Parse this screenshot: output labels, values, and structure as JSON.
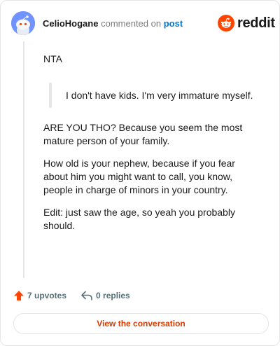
{
  "header": {
    "author": "CelioHogane",
    "action": "commented on",
    "post_link": "post",
    "brand": "reddit",
    "brand_color": "#ff4500"
  },
  "comment": {
    "paragraphs": {
      "nta": "NTA",
      "quote": "I don't have kids. I'm very immature myself.",
      "p1": "ARE YOU THO? Because you seem the most mature person of your family.",
      "p2": "How old is your nephew, because if you fear about him you might want to call, you know, people in charge of minors in your country.",
      "p3": "Edit: just saw the age, so yeah you probably should."
    }
  },
  "footer": {
    "upvotes_label": "7 upvotes",
    "replies_label": "0 replies",
    "upvote_icon": "upvote-arrow-icon",
    "reply_icon": "reply-arrow-icon"
  },
  "cta": {
    "label": "View the conversation",
    "color": "#d93a00"
  }
}
